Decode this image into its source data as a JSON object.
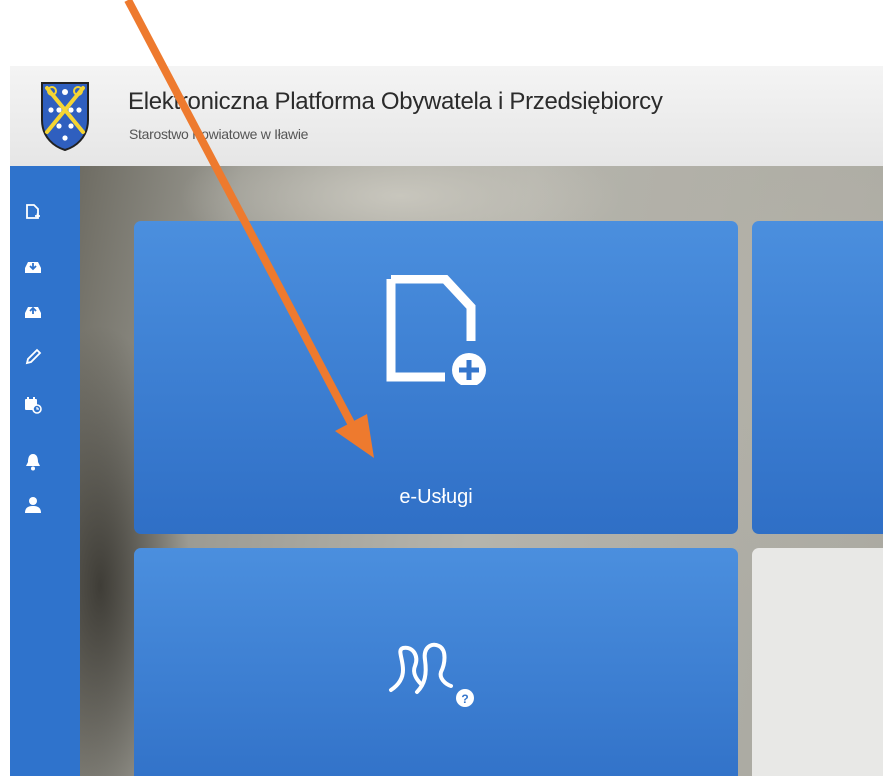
{
  "header": {
    "title": "Elektroniczna Platforma Obywatela i Przedsiębiorcy",
    "subtitle": "Starostwo Powiatowe w Iławie"
  },
  "sidebar": {
    "items": [
      {
        "icon": "new-document-icon"
      },
      {
        "icon": "inbox-icon"
      },
      {
        "icon": "outbox-icon"
      },
      {
        "icon": "pencil-icon"
      },
      {
        "icon": "calendar-clock-icon"
      },
      {
        "icon": "bell-icon"
      },
      {
        "icon": "user-icon"
      }
    ]
  },
  "tiles": [
    {
      "label": "e-Usługi",
      "icon": "new-document-plus-icon"
    },
    {
      "label": "",
      "icon": "help-people-icon"
    }
  ],
  "colors": {
    "sidebar": "#2f73cc",
    "tile": "#3a7dd2",
    "annotation_arrow": "#ee7a2e"
  }
}
